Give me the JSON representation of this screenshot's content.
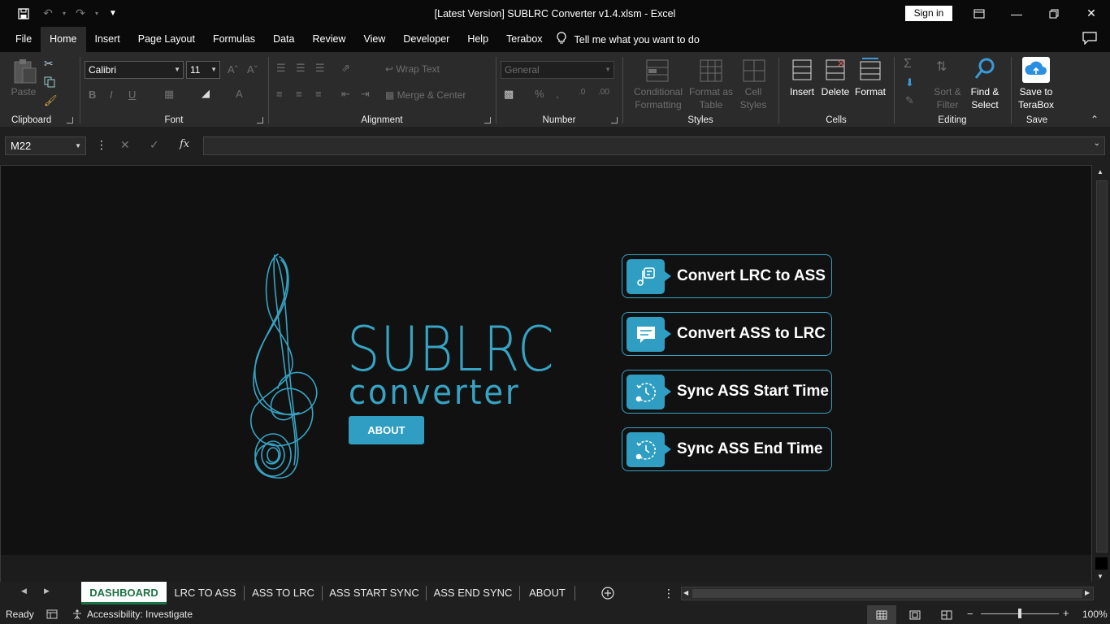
{
  "window": {
    "title": "[Latest Version] SUBLRC Converter v1.4.xlsm  -  Excel",
    "sign_in": "Sign in"
  },
  "ribbon_tabs": [
    "File",
    "Home",
    "Insert",
    "Page Layout",
    "Formulas",
    "Data",
    "Review",
    "View",
    "Developer",
    "Help",
    "Terabox"
  ],
  "tell_me": "Tell me what you want to do",
  "ribbon": {
    "clipboard": {
      "label": "Clipboard",
      "paste": "Paste"
    },
    "font": {
      "label": "Font",
      "name": "Calibri",
      "size": "11"
    },
    "alignment": {
      "label": "Alignment",
      "wrap": "Wrap Text",
      "merge": "Merge & Center"
    },
    "number": {
      "label": "Number",
      "format": "General"
    },
    "styles": {
      "label": "Styles",
      "conditional_1": "Conditional",
      "conditional_2": "Formatting",
      "format_table_1": "Format as",
      "format_table_2": "Table",
      "cell_styles_1": "Cell",
      "cell_styles_2": "Styles"
    },
    "cells": {
      "label": "Cells",
      "insert": "Insert",
      "delete": "Delete",
      "format": "Format"
    },
    "editing": {
      "label": "Editing",
      "sort_1": "Sort &",
      "sort_2": "Filter",
      "find_1": "Find &",
      "find_2": "Select"
    },
    "save": {
      "label": "Save",
      "save_1": "Save to",
      "save_2": "TeraBox"
    }
  },
  "formula_bar": {
    "name_box": "M22",
    "fx": "fx",
    "value": ""
  },
  "dashboard": {
    "brand_title": "SUBLRC",
    "brand_subtitle": "converter",
    "about_button": "ABOUT",
    "actions": [
      {
        "label": "Convert LRC to ASS",
        "icon": "music-note-icon"
      },
      {
        "label": "Convert ASS to LRC",
        "icon": "chat-bubble-icon"
      },
      {
        "label": "Sync ASS Start Time",
        "icon": "clock-sync-icon"
      },
      {
        "label": "Sync ASS End Time",
        "icon": "clock-sync-icon"
      }
    ]
  },
  "sheet_tabs": [
    "DASHBOARD",
    "LRC TO ASS",
    "ASS TO LRC",
    "ASS START SYNC",
    "ASS END SYNC",
    "ABOUT"
  ],
  "active_sheet": "DASHBOARD",
  "status": {
    "ready": "Ready",
    "accessibility": "Accessibility: Investigate",
    "zoom": "100%"
  },
  "colors": {
    "accent": "#37a3c3",
    "button": "#2f9ec2",
    "active_tab_text": "#1e7145"
  }
}
